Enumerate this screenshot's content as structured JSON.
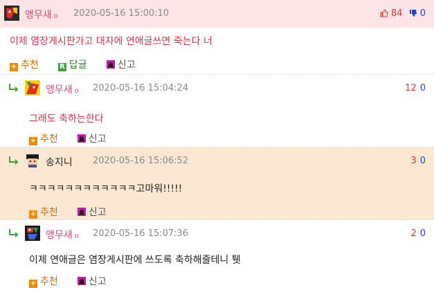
{
  "comments": [
    {
      "nickname": "앵무새",
      "level": "o",
      "date": "2020-05-16 15:00:10",
      "body": "이제 염장게시판가고 대자에 연애글쓰면 죽는다 너",
      "up": "84",
      "down": "0",
      "actions": {
        "recommend": "추천",
        "reply": "답글",
        "report": "신고"
      }
    },
    {
      "nickname": "앵무새",
      "level": "o",
      "date": "2020-05-16 15:04:24",
      "body": "그래도 축하는한다",
      "up": "12",
      "down": "0",
      "actions": {
        "recommend": "추천",
        "report": "신고"
      }
    },
    {
      "nickname": "송지니",
      "date": "2020-05-16 15:06:52",
      "body": "ㅋㅋㅋㅋㅋㅋㅋㅋㅋㅋㅋㅋ고마워!!!!!",
      "up": "3",
      "down": "0",
      "actions": {
        "recommend": "추천",
        "report": "신고"
      }
    },
    {
      "nickname": "앵무새",
      "level": "o",
      "date": "2020-05-16 15:07:36",
      "body": "이제 연애글은 염장게시판에 쓰도록 축하해줄테니 퉷",
      "up": "2",
      "down": "0",
      "actions": {
        "recommend": "추천",
        "report": "신고"
      }
    }
  ],
  "icons": {
    "thumbs_up": "thumbs-up-icon",
    "thumbs_down": "thumbs-down-icon",
    "reply_arrow": "reply-arrow-icon",
    "recommend": "plus-icon",
    "reply": "reply-badge-icon",
    "report": "siren-icon"
  },
  "colors": {
    "first_bg": "#fde4e6",
    "highlight_bg": "#fce8d2",
    "nick_pink": "#e0457b",
    "body_red": "#e0344a",
    "up_red": "#e33",
    "down_blue": "#2244cc",
    "action_orange": "#e36a00"
  }
}
